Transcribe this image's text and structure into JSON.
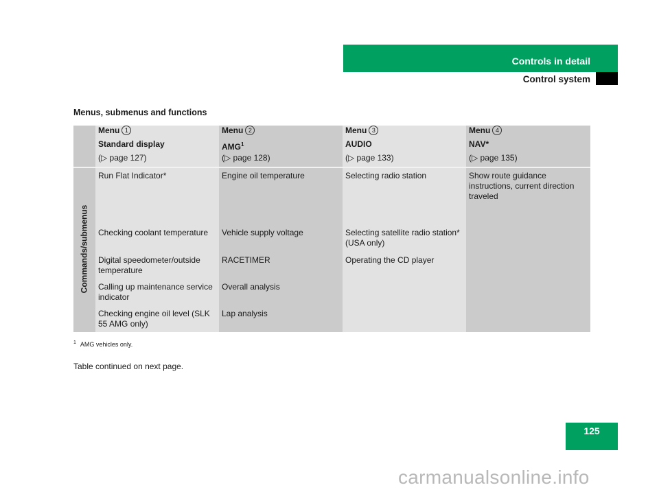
{
  "header": {
    "chapter": "Controls in detail",
    "section": "Control system",
    "accent_color": "#00a060"
  },
  "section_title": "Menus, submenus and functions",
  "table": {
    "row_header": "Commands/submenus",
    "columns": [
      {
        "menu": "Menu",
        "number": "1",
        "name": "Standard display",
        "name_sup": "",
        "page_ref": "(▷ page 127)"
      },
      {
        "menu": "Menu",
        "number": "2",
        "name": "AMG",
        "name_sup": "1",
        "page_ref": "(▷ page 128)"
      },
      {
        "menu": "Menu",
        "number": "3",
        "name": "AUDIO",
        "name_sup": "",
        "page_ref": "(▷ page 133)"
      },
      {
        "menu": "Menu",
        "number": "4",
        "name": "NAV*",
        "name_sup": "",
        "page_ref": "(▷ page 135)"
      }
    ],
    "rows": [
      [
        "Run Flat Indicator*",
        "Engine oil temperature",
        "Selecting radio station",
        "Show route guidance instructions, current direction traveled"
      ],
      [
        "Checking coolant temperature",
        "Vehicle supply voltage",
        "Selecting satellite radio station* (USA only)",
        ""
      ],
      [
        "Digital speedometer/outside temperature",
        "RACETIMER",
        "Operating the CD player",
        ""
      ],
      [
        "Calling up maintenance service indicator",
        "Overall analysis",
        "",
        ""
      ],
      [
        "Checking engine oil level (SLK 55 AMG only)",
        "Lap analysis",
        "",
        ""
      ]
    ]
  },
  "footnote": {
    "marker": "1",
    "text": "AMG vehicles only."
  },
  "continued_note": "Table continued on next page.",
  "page_number": "125",
  "watermark": "carmanualsonline.info"
}
